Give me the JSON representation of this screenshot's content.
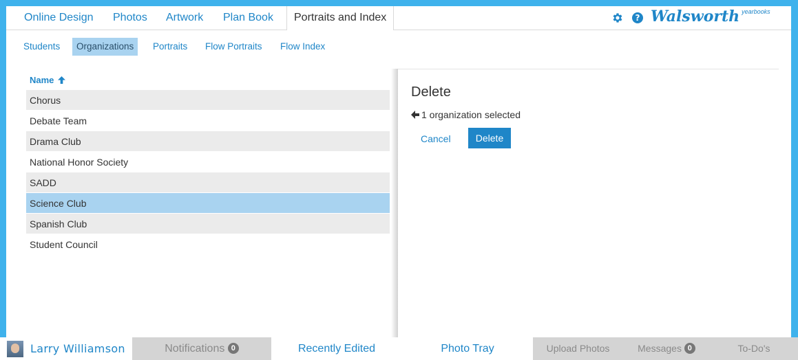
{
  "topnav": {
    "tabs": [
      "Online Design",
      "Photos",
      "Artwork",
      "Plan Book"
    ],
    "active_tab": "Portraits and Index",
    "settings_icon": "gear-icon",
    "help_icon": "help-icon",
    "help_glyph": "?",
    "logo_brand": "Walsworth",
    "logo_sub": "yearbooks"
  },
  "subnav": {
    "tabs": [
      "Students",
      "Organizations",
      "Portraits",
      "Flow Portraits",
      "Flow Index"
    ],
    "active": "Organizations"
  },
  "list": {
    "header": "Name",
    "sort_icon": "arrow-up-icon",
    "rows": [
      "Chorus",
      "Debate Team",
      "Drama Club",
      "National Honor Society",
      "SADD",
      "Science Club",
      "Spanish Club",
      "Student Council"
    ],
    "selected": "Science Club"
  },
  "panel": {
    "title": "Delete",
    "back_icon": "arrow-left-icon",
    "selection_text": "1 organization selected",
    "cancel_label": "Cancel",
    "delete_label": "Delete"
  },
  "bottombar": {
    "user_name": "Larry Williamson",
    "notifications_label": "Notifications",
    "notifications_count": "0",
    "recently_edited_label": "Recently Edited",
    "photo_tray_label": "Photo Tray",
    "upload_photos_label": "Upload Photos",
    "messages_label": "Messages",
    "messages_count": "0",
    "todos_label": "To-Do's"
  },
  "colors": {
    "frame": "#3fb2ec",
    "accent": "#1f86c8",
    "selected_row": "#a9d3f0",
    "alt_row": "#ebebeb",
    "bottom_bar": "#d4d4d4"
  }
}
